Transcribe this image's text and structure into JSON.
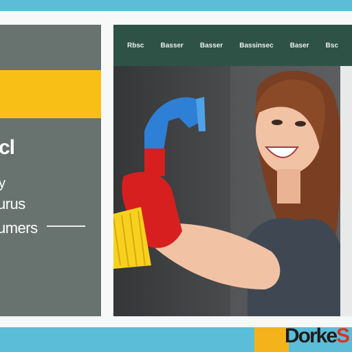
{
  "nav": {
    "items": [
      "Rbsc",
      "Basser",
      "Basser",
      "Bassinsec",
      "Baser",
      "Bsc"
    ]
  },
  "sidebar": {
    "heading": "cl",
    "line1": "y",
    "line2": "urus",
    "line3": "umers"
  },
  "logo": {
    "text_main": "Dorke",
    "text_accent": "S"
  },
  "colors": {
    "accent_yellow": "#f8bf16",
    "nav_green": "#2f5246",
    "band_blue": "#5bbdd8",
    "panel_gray": "#68736f"
  }
}
